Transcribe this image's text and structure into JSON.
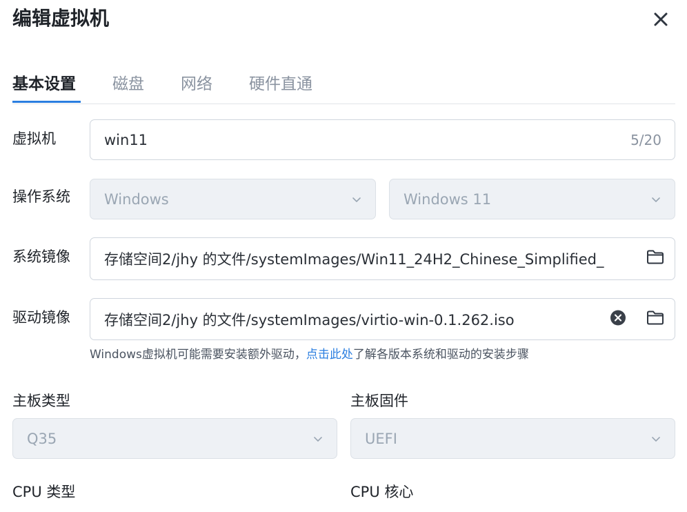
{
  "dialog": {
    "title": "编辑虚拟机"
  },
  "tabs": [
    {
      "label": "基本设置",
      "active": true
    },
    {
      "label": "磁盘",
      "active": false
    },
    {
      "label": "网络",
      "active": false
    },
    {
      "label": "硬件直通",
      "active": false
    }
  ],
  "form": {
    "vm_name": {
      "label": "虚拟机",
      "value": "win11",
      "counter": "5/20"
    },
    "os": {
      "label": "操作系统",
      "type_value": "Windows",
      "version_value": "Windows 11"
    },
    "system_image": {
      "label": "系统镜像",
      "value": "存储空间2/jhy 的文件/systemImages/Win11_24H2_Chinese_Simplified_"
    },
    "driver_image": {
      "label": "驱动镜像",
      "value": "存储空间2/jhy 的文件/systemImages/virtio-win-0.1.262.iso"
    },
    "hint": {
      "before": "Windows虚拟机可能需要安装额外驱动，",
      "link": "点击此处",
      "after": "了解各版本系统和驱动的安装步骤"
    },
    "board_type": {
      "label": "主板类型",
      "value": "Q35"
    },
    "firmware": {
      "label": "主板固件",
      "value": "UEFI"
    },
    "cpu_type": {
      "label": "CPU 类型"
    },
    "cpu_cores": {
      "label": "CPU 核心"
    }
  },
  "colors": {
    "accent": "#2a7ee0",
    "text": "#1f2329",
    "muted": "#8a93a0",
    "disabled_bg": "#eef1f5"
  },
  "icons": {
    "close": "close-icon",
    "chevron": "chevron-down-icon",
    "folder": "folder-icon",
    "clear": "clear-icon"
  }
}
